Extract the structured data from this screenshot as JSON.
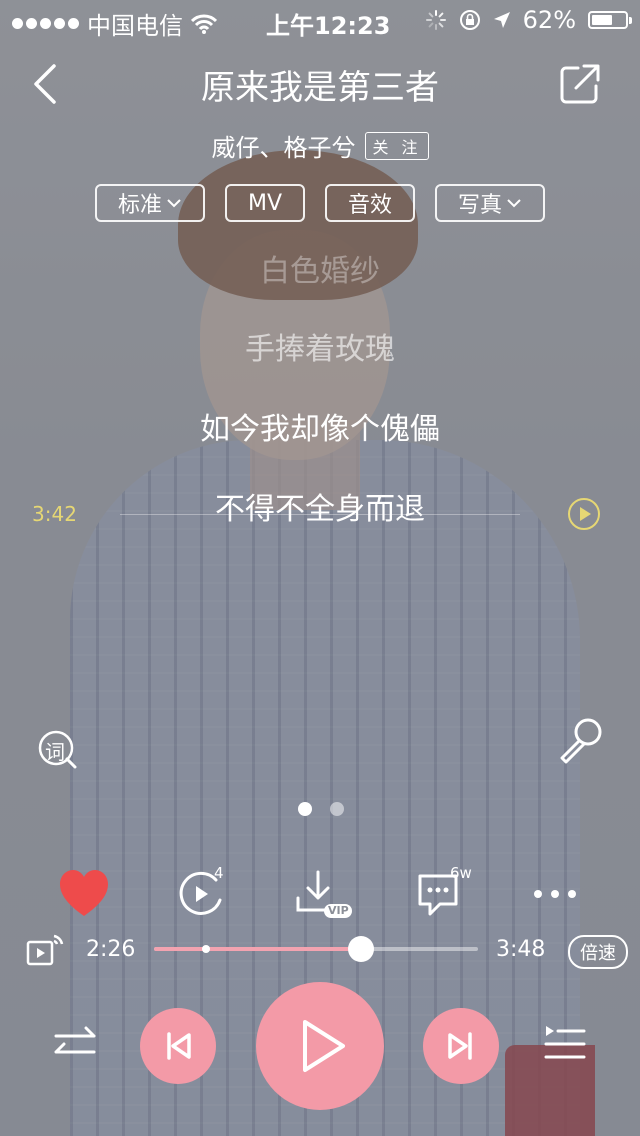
{
  "status_bar": {
    "carrier": "中国电信",
    "time": "上午12:23",
    "battery_text": "62%",
    "battery_level": 0.62
  },
  "header": {
    "song_title": "原来我是第三者",
    "artists": "威仔、格子兮",
    "follow_label": "关 注"
  },
  "chips": {
    "quality": "标准",
    "mv": "MV",
    "effects": "音效",
    "photos": "写真"
  },
  "lyrics": [
    "白色婚纱",
    "手捧着玫瑰",
    "如今我却像个傀儡",
    "不得不全身而退"
  ],
  "seek_preview_time": "3:42",
  "side_buttons": {
    "lyric_char": "词"
  },
  "pager": {
    "pages": 2,
    "active": 0
  },
  "actions": {
    "loop_count": "4",
    "download_badge": "VIP",
    "comment_count": "6w"
  },
  "progress": {
    "current": "2:26",
    "total": "3:48",
    "played_fraction": 0.64,
    "buffer_marker_fraction": 0.16,
    "speed_label": "倍速"
  },
  "colors": {
    "accent_pink": "#f39aa7",
    "progress_pink": "#f2a3b0",
    "heart_red": "#ee4b4b",
    "seek_yellow": "#e6d774"
  }
}
